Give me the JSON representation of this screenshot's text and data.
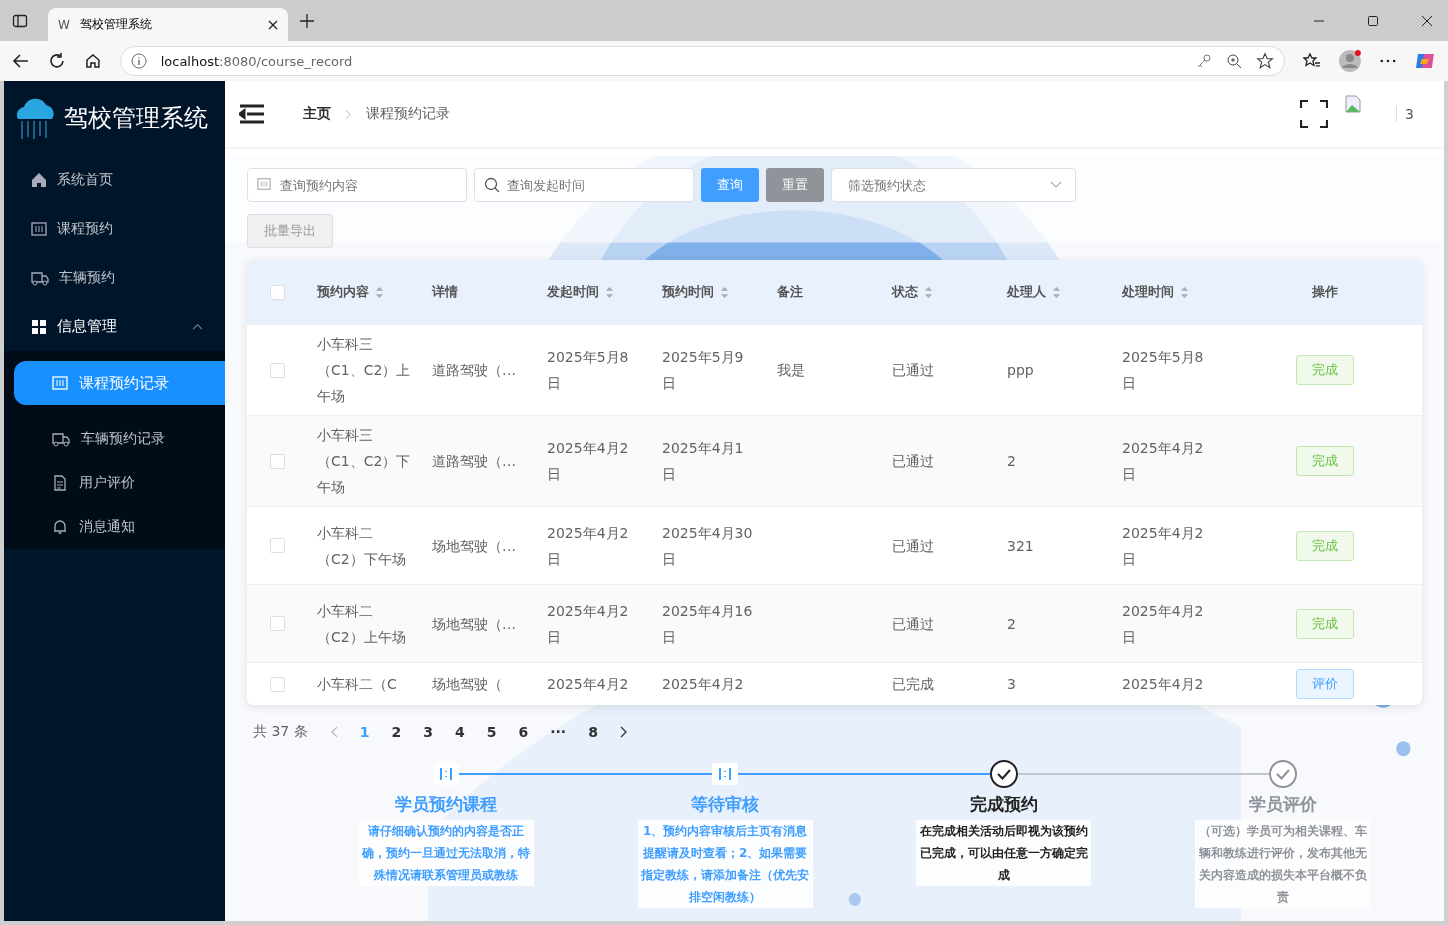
{
  "browser": {
    "favicon": "W",
    "tab_title": "驾校管理系统",
    "url_host": "localhost",
    "url_path": ":8080/course_record"
  },
  "sidebar": {
    "logo_title": "驾校管理系统",
    "items": [
      {
        "label": "系统首页",
        "selected": false
      },
      {
        "label": "课程预约",
        "selected": false
      },
      {
        "label": "车辆预约",
        "selected": false
      },
      {
        "label": "信息管理",
        "selected": false,
        "expanded": true,
        "children": [
          {
            "label": "课程预约记录",
            "selected": true
          },
          {
            "label": "车辆预约记录",
            "selected": false
          },
          {
            "label": "用户评价",
            "selected": false
          },
          {
            "label": "消息通知",
            "selected": false
          }
        ]
      }
    ]
  },
  "header": {
    "breadcrumb": [
      "主页",
      "课程预约记录"
    ],
    "user_count": "3"
  },
  "filters": {
    "content_placeholder": "查询预约内容",
    "time_placeholder": "查询发起时间",
    "search_button": "查询",
    "reset_button": "重置",
    "status_placeholder": "筛选预约状态",
    "export_button": {
      "label": "批量导出",
      "disabled": true
    }
  },
  "table": {
    "all_checked": false,
    "columns": [
      {
        "label": "预约内容",
        "sortable": true
      },
      {
        "label": "详情",
        "sortable": false
      },
      {
        "label": "发起时间",
        "sortable": true
      },
      {
        "label": "预约时间",
        "sortable": true
      },
      {
        "label": "备注",
        "sortable": false
      },
      {
        "label": "状态",
        "sortable": true
      },
      {
        "label": "处理人",
        "sortable": true
      },
      {
        "label": "处理时间",
        "sortable": true
      },
      {
        "label": "操作",
        "sortable": false
      }
    ],
    "rows": [
      {
        "checked": false,
        "cells": [
          "小车科三（C1、C2）上午场",
          "道路驾驶（…",
          "2025年5月8日",
          "2025年5月9日",
          "我是",
          "已通过",
          "ppp",
          "2025年5月8日"
        ],
        "action": {
          "label": "完成",
          "kind": "complete"
        }
      },
      {
        "checked": false,
        "cells": [
          "小车科三（C1、C2）下午场",
          "道路驾驶（…",
          "2025年4月2日",
          "2025年4月1日",
          "",
          "已通过",
          "2",
          "2025年4月2日"
        ],
        "action": {
          "label": "完成",
          "kind": "complete"
        }
      },
      {
        "checked": false,
        "cells": [
          "小车科二（C2）下午场",
          "场地驾驶（…",
          "2025年4月2日",
          "2025年4月30日",
          "",
          "已通过",
          "321",
          "2025年4月2日"
        ],
        "action": {
          "label": "完成",
          "kind": "complete"
        }
      },
      {
        "checked": false,
        "cells": [
          "小车科二（C2）上午场",
          "场地驾驶（…",
          "2025年4月2日",
          "2025年4月16日",
          "",
          "已通过",
          "2",
          "2025年4月2日"
        ],
        "action": {
          "label": "完成",
          "kind": "complete"
        }
      },
      {
        "checked": false,
        "cells": [
          "小车科二（C",
          "场地驾驶（",
          "2025年4月2",
          "2025年4月2",
          "",
          "已完成",
          "3",
          "2025年4月2"
        ],
        "action": {
          "label": "评价",
          "kind": "review"
        }
      }
    ]
  },
  "pagination": {
    "total": "共 37 条",
    "pages": [
      {
        "label": "1",
        "selected": true
      },
      {
        "label": "2",
        "selected": false
      },
      {
        "label": "3",
        "selected": false
      },
      {
        "label": "4",
        "selected": false
      },
      {
        "label": "5",
        "selected": false
      },
      {
        "label": "6",
        "selected": false
      },
      {
        "label": "···",
        "selected": false
      },
      {
        "label": "8",
        "selected": false
      }
    ]
  },
  "steps": [
    {
      "title": "学员预约课程",
      "description": "请仔细确认预约的内容是否正确，预约一旦通过无法取消，特殊情况请联系管理员或教练",
      "kind": "finish"
    },
    {
      "title": "等待审核",
      "description": "1、预约内容审核后主页有消息提醒请及时查看；2、如果需要指定教练，请添加备注（优先安排空闲教练）",
      "kind": "finish"
    },
    {
      "title": "完成预约",
      "description": "在完成相关活动后即视为该预约已完成，可以由任意一方确定完成",
      "kind": "process"
    },
    {
      "title": "学员评价",
      "description": "（可选）学员可为相关课程、车辆和教练进行评价，发布其他无关内容造成的损失本平台概不负责",
      "kind": "wait"
    }
  ]
}
